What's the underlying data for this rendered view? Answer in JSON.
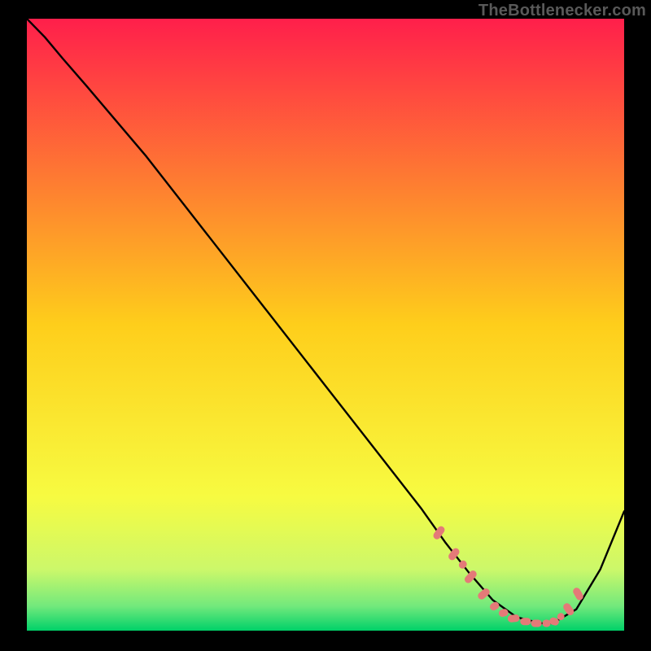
{
  "watermark": "TheBottlenecker.com",
  "chart_data": {
    "type": "line",
    "title": "",
    "xlabel": "",
    "ylabel": "",
    "xlim": [
      0,
      100
    ],
    "ylim": [
      0,
      100
    ],
    "grid": false,
    "gradient_stops": [
      {
        "offset": 0.0,
        "color": "#ff1f4b"
      },
      {
        "offset": 0.5,
        "color": "#fece1b"
      },
      {
        "offset": 0.78,
        "color": "#f7fb41"
      },
      {
        "offset": 0.9,
        "color": "#ccf86a"
      },
      {
        "offset": 0.96,
        "color": "#72e97c"
      },
      {
        "offset": 1.0,
        "color": "#00d169"
      }
    ],
    "series": [
      {
        "name": "bottleneck-curve",
        "x": [
          0,
          3,
          6,
          10,
          20,
          30,
          40,
          50,
          58,
          62,
          66,
          70,
          74,
          78,
          82,
          86,
          88,
          92,
          96,
          100
        ],
        "y": [
          100,
          97,
          93.5,
          89,
          77.5,
          65,
          52.5,
          40,
          30,
          25,
          20,
          14.5,
          9.5,
          5,
          2.2,
          1.2,
          1.2,
          3.5,
          10,
          19.5
        ]
      }
    ],
    "markers": {
      "color": "#e47a78",
      "shape": "capsule",
      "points": [
        {
          "x": 69.0,
          "y": 16.0,
          "len": 2.4,
          "angle": -55
        },
        {
          "x": 71.5,
          "y": 12.5,
          "len": 2.2,
          "angle": -52
        },
        {
          "x": 73.0,
          "y": 10.8,
          "len": 1.4,
          "angle": -50
        },
        {
          "x": 74.3,
          "y": 8.8,
          "len": 2.4,
          "angle": -48
        },
        {
          "x": 76.5,
          "y": 6.0,
          "len": 2.2,
          "angle": -40
        },
        {
          "x": 78.3,
          "y": 4.0,
          "len": 1.6,
          "angle": -30
        },
        {
          "x": 79.8,
          "y": 2.9,
          "len": 1.6,
          "angle": -16
        },
        {
          "x": 81.5,
          "y": 2.0,
          "len": 2.0,
          "angle": -6
        },
        {
          "x": 83.5,
          "y": 1.5,
          "len": 1.8,
          "angle": 0
        },
        {
          "x": 85.3,
          "y": 1.2,
          "len": 1.8,
          "angle": 0
        },
        {
          "x": 87.0,
          "y": 1.2,
          "len": 1.4,
          "angle": 0
        },
        {
          "x": 88.3,
          "y": 1.5,
          "len": 1.6,
          "angle": 18
        },
        {
          "x": 89.4,
          "y": 2.3,
          "len": 1.2,
          "angle": 40
        },
        {
          "x": 90.7,
          "y": 3.5,
          "len": 2.2,
          "angle": 55
        },
        {
          "x": 92.3,
          "y": 6.0,
          "len": 2.2,
          "angle": 60
        }
      ]
    }
  }
}
